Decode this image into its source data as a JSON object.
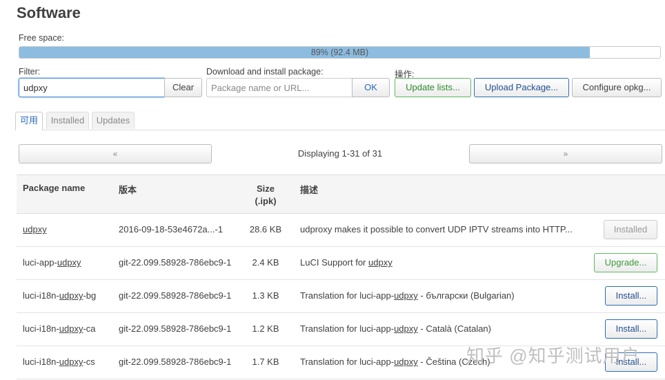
{
  "page": {
    "title": "Software"
  },
  "free_space": {
    "label": "Free space:",
    "text": "89% (92.4 MB)",
    "percent": 89
  },
  "filter": {
    "label": "Filter:",
    "value": "udpxy",
    "clear_label": "Clear"
  },
  "download": {
    "label": "Download and install package:",
    "placeholder": "Package name or URL...",
    "ok_label": "OK"
  },
  "actions": {
    "label": "操作:",
    "update_lists": "Update lists...",
    "upload_package": "Upload Package...",
    "configure_opkg": "Configure opkg..."
  },
  "tabs": [
    {
      "label": "可用",
      "active": true
    },
    {
      "label": "Installed",
      "active": false
    },
    {
      "label": "Updates",
      "active": false
    }
  ],
  "pager": {
    "prev": "«",
    "next": "»",
    "display": "Displaying 1-31 of 31"
  },
  "table": {
    "headers": {
      "name": "Package name",
      "version": "版本",
      "size_line1": "Size",
      "size_line2": "(.ipk)",
      "description": "描述"
    },
    "rows": [
      {
        "name_pre": "",
        "name_u": "udpxy",
        "name_post": "",
        "version": "2016-09-18-53e4672a...-1",
        "size": "28.6 KB",
        "desc_pre": "udproxy makes it possible to convert UDP IPTV streams into HTTP...",
        "desc_u": "",
        "desc_post": "",
        "action": "Installed",
        "action_type": "installed"
      },
      {
        "name_pre": "luci-app-",
        "name_u": "udpxy",
        "name_post": "",
        "version": "git-22.099.58928-786ebc9-1",
        "size": "2.4 KB",
        "desc_pre": "LuCI Support for ",
        "desc_u": "udpxy",
        "desc_post": "",
        "action": "Upgrade...",
        "action_type": "upgrade"
      },
      {
        "name_pre": "luci-i18n-",
        "name_u": "udpxy",
        "name_post": "-bg",
        "version": "git-22.099.58928-786ebc9-1",
        "size": "1.3 KB",
        "desc_pre": "Translation for luci-app-",
        "desc_u": "udpxy",
        "desc_post": " - български (Bulgarian)",
        "action": "Install...",
        "action_type": "install"
      },
      {
        "name_pre": "luci-i18n-",
        "name_u": "udpxy",
        "name_post": "-ca",
        "version": "git-22.099.58928-786ebc9-1",
        "size": "1.2 KB",
        "desc_pre": "Translation for luci-app-",
        "desc_u": "udpxy",
        "desc_post": " - Català (Catalan)",
        "action": "Install...",
        "action_type": "install"
      },
      {
        "name_pre": "luci-i18n-",
        "name_u": "udpxy",
        "name_post": "-cs",
        "version": "git-22.099.58928-786ebc9-1",
        "size": "1.7 KB",
        "desc_pre": "Translation for luci-app-",
        "desc_u": "udpxy",
        "desc_post": " - Čeština (Czech)",
        "action": "Install...",
        "action_type": "install"
      }
    ]
  },
  "watermark": "知乎 @知乎测试用户"
}
